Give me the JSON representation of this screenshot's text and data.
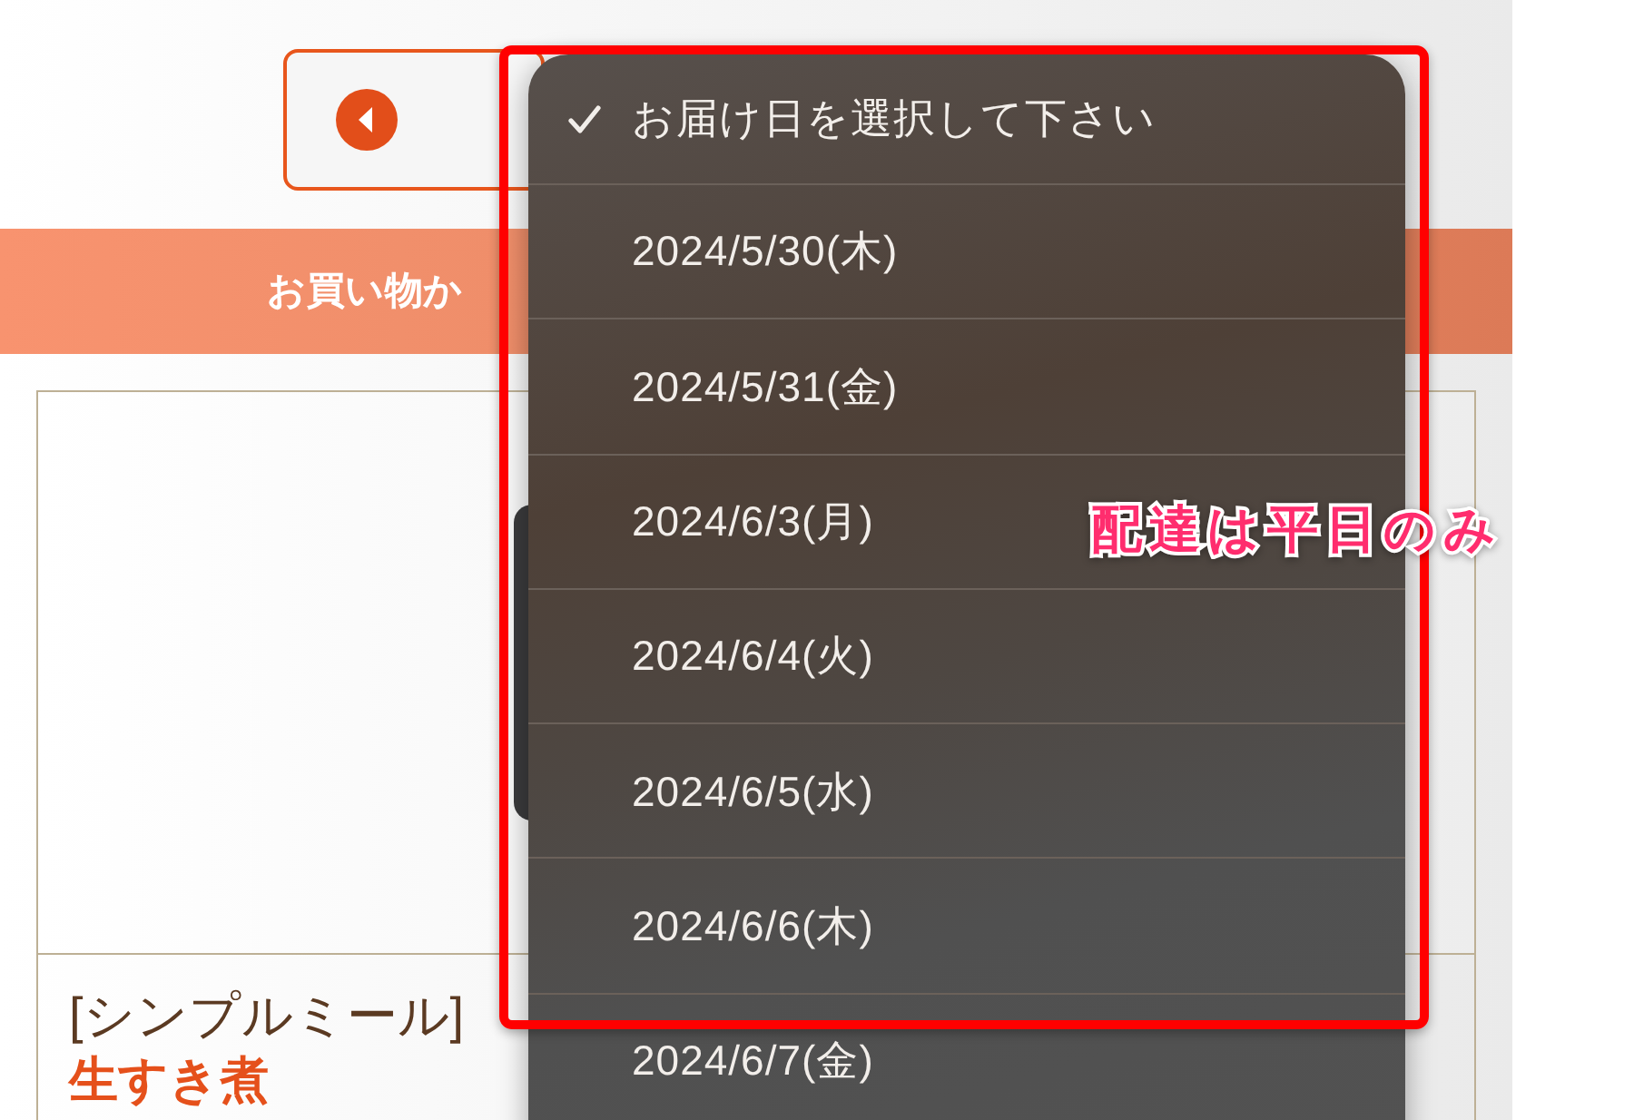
{
  "banner": {
    "text": "お買い物か"
  },
  "product": {
    "category": "[シンプルミール]",
    "name": "生すき煮"
  },
  "date_picker": {
    "options": [
      {
        "label": "お届け日を選択して下さい",
        "selected": true
      },
      {
        "label": "2024/5/30(木)",
        "selected": false
      },
      {
        "label": "2024/5/31(金)",
        "selected": false
      },
      {
        "label": "2024/6/3(月)",
        "selected": false
      },
      {
        "label": "2024/6/4(火)",
        "selected": false
      },
      {
        "label": "2024/6/5(水)",
        "selected": false
      },
      {
        "label": "2024/6/6(木)",
        "selected": false
      },
      {
        "label": "2024/6/7(金)",
        "selected": false
      }
    ]
  },
  "annotation": {
    "note": "配達は平日のみ"
  }
}
